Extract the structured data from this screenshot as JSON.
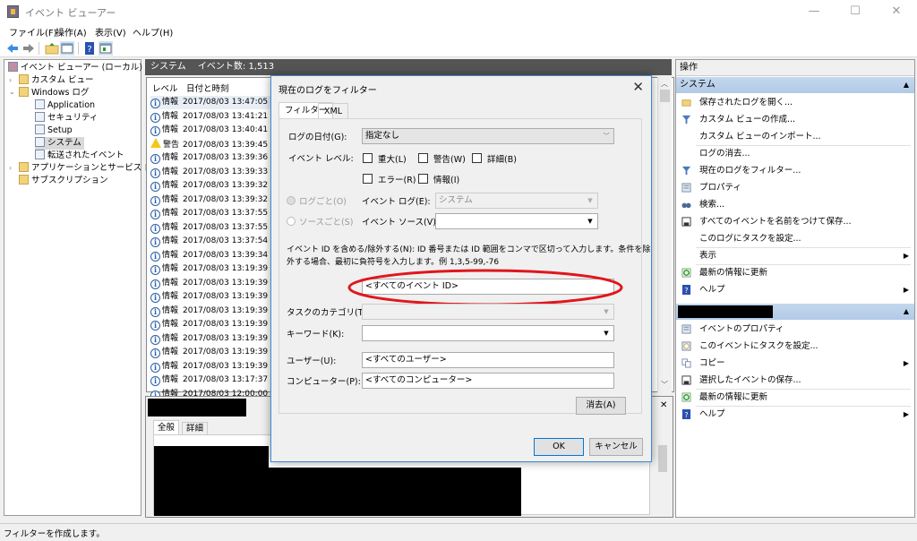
{
  "window": {
    "title": "イベント ビューアー",
    "controls": {
      "minimize": "—",
      "maximize": "☐",
      "close": "✕"
    }
  },
  "menubar": [
    "ファイル(F)",
    "操作(A)",
    "表示(V)",
    "ヘルプ(H)"
  ],
  "toolbar": {
    "icons": [
      "back-arrow-icon",
      "forward-arrow-icon",
      "up-folder-icon",
      "show-hide-tree-icon",
      "help-icon",
      "show-hide-action-pane-icon"
    ]
  },
  "tree": {
    "root": "イベント ビューアー (ローカル)",
    "items": [
      {
        "label": "カスタム ビュー",
        "level": 1,
        "expander": "›"
      },
      {
        "label": "Windows ログ",
        "level": 1,
        "expander": "⌄"
      },
      {
        "label": "Application",
        "level": 2
      },
      {
        "label": "セキュリティ",
        "level": 2
      },
      {
        "label": "Setup",
        "level": 2
      },
      {
        "label": "システム",
        "level": 2,
        "selected": true
      },
      {
        "label": "転送されたイベント",
        "level": 2
      },
      {
        "label": "アプリケーションとサービス ログ",
        "level": 1,
        "expander": "›"
      },
      {
        "label": "サブスクリプション",
        "level": 1
      }
    ]
  },
  "center": {
    "header_name": "システム",
    "header_count": "イベント数: 1,513",
    "columns": [
      "レベル",
      "日付と時刻"
    ],
    "events": [
      {
        "level": "情報",
        "type": "info",
        "datetime": "2017/08/03 13:47:05"
      },
      {
        "level": "情報",
        "type": "info",
        "datetime": "2017/08/03 13:41:21"
      },
      {
        "level": "情報",
        "type": "info",
        "datetime": "2017/08/03 13:40:41"
      },
      {
        "level": "警告",
        "type": "warning",
        "datetime": "2017/08/03 13:39:45"
      },
      {
        "level": "情報",
        "type": "info",
        "datetime": "2017/08/03 13:39:36"
      },
      {
        "level": "情報",
        "type": "info",
        "datetime": "2017/08/03 13:39:33"
      },
      {
        "level": "情報",
        "type": "info",
        "datetime": "2017/08/03 13:39:32"
      },
      {
        "level": "情報",
        "type": "info",
        "datetime": "2017/08/03 13:39:32"
      },
      {
        "level": "情報",
        "type": "info",
        "datetime": "2017/08/03 13:37:55"
      },
      {
        "level": "情報",
        "type": "info",
        "datetime": "2017/08/03 13:37:55"
      },
      {
        "level": "情報",
        "type": "info",
        "datetime": "2017/08/03 13:37:54"
      },
      {
        "level": "情報",
        "type": "info",
        "datetime": "2017/08/03 13:39:34"
      },
      {
        "level": "情報",
        "type": "info",
        "datetime": "2017/08/03 13:19:39"
      },
      {
        "level": "情報",
        "type": "info",
        "datetime": "2017/08/03 13:19:39"
      },
      {
        "level": "情報",
        "type": "info",
        "datetime": "2017/08/03 13:19:39"
      },
      {
        "level": "情報",
        "type": "info",
        "datetime": "2017/08/03 13:19:39"
      },
      {
        "level": "情報",
        "type": "info",
        "datetime": "2017/08/03 13:19:39"
      },
      {
        "level": "情報",
        "type": "info",
        "datetime": "2017/08/03 13:19:39"
      },
      {
        "level": "情報",
        "type": "info",
        "datetime": "2017/08/03 13:19:39"
      },
      {
        "level": "情報",
        "type": "info",
        "datetime": "2017/08/03 13:19:39"
      },
      {
        "level": "情報",
        "type": "info",
        "datetime": "2017/08/03 13:17:37"
      },
      {
        "level": "情報",
        "type": "info",
        "datetime": "2017/08/03 12:00:00"
      }
    ],
    "detail_tabs": [
      "全般",
      "詳細"
    ],
    "detail_close": "✕"
  },
  "dialog": {
    "title": "現在のログをフィルター",
    "close": "✕",
    "tabs": [
      "フィルター",
      "XML"
    ],
    "log_date_label": "ログの日付(G):",
    "log_date_value": "指定なし",
    "event_level_label": "イベント レベル:",
    "levels": [
      {
        "label": "重大(L)",
        "checked": false
      },
      {
        "label": "警告(W)",
        "checked": false
      },
      {
        "label": "詳細(B)",
        "checked": false
      },
      {
        "label": "エラー(R)",
        "checked": false
      },
      {
        "label": "情報(I)",
        "checked": false
      }
    ],
    "by_log_label": "ログごと(O)",
    "by_source_label": "ソースごと(S)",
    "event_log_label": "イベント ログ(E):",
    "event_log_value": "システム",
    "event_source_label": "イベント ソース(V):",
    "event_source_value": "",
    "event_id_help_1": "イベント ID を含める/除外する(N): ID 番号または ID 範囲をコンマで区切って入力します。条件を除",
    "event_id_help_2": "外する場合、最初に負符号を入力します。例 1,3,5-99,-76",
    "event_id_value": "<すべてのイベント ID>",
    "task_category_label": "タスクのカテゴリ(T):",
    "keyword_label": "キーワード(K):",
    "user_label": "ユーザー(U):",
    "user_value": "<すべてのユーザー>",
    "computer_label": "コンピューター(P):",
    "computer_value": "<すべてのコンピューター>",
    "clear_button": "消去(A)",
    "ok_button": "OK",
    "cancel_button": "キャンセル",
    "highlight_color": "#e0161c"
  },
  "actions": {
    "header": "操作",
    "section1_title": "システム",
    "section1": [
      {
        "label": "保存されたログを開く...",
        "icon": "open-folder-icon"
      },
      {
        "label": "カスタム ビューの作成...",
        "icon": "filter-icon"
      },
      {
        "label": "カスタム ビューのインポート...",
        "icon": ""
      },
      {
        "label": "ログの消去...",
        "icon": ""
      },
      {
        "label": "現在のログをフィルター...",
        "icon": "filter-icon"
      },
      {
        "label": "プロパティ",
        "icon": "properties-icon"
      },
      {
        "label": "検索...",
        "icon": "binoculars-icon"
      },
      {
        "label": "すべてのイベントを名前をつけて保存...",
        "icon": "save-icon"
      },
      {
        "label": "このログにタスクを設定...",
        "icon": ""
      },
      {
        "label": "表示",
        "icon": "",
        "submenu": true
      },
      {
        "label": "最新の情報に更新",
        "icon": "refresh-icon"
      },
      {
        "label": "ヘルプ",
        "icon": "help-icon",
        "submenu": true
      }
    ],
    "section2": [
      {
        "label": "イベントのプロパティ",
        "icon": "properties-icon"
      },
      {
        "label": "このイベントにタスクを設定...",
        "icon": "task-icon"
      },
      {
        "label": "コピー",
        "icon": "copy-icon",
        "submenu": true
      },
      {
        "label": "選択したイベントの保存...",
        "icon": "save-icon"
      },
      {
        "label": "最新の情報に更新",
        "icon": "refresh-icon"
      },
      {
        "label": "ヘルプ",
        "icon": "help-icon",
        "submenu": true
      }
    ],
    "collapse": "▲",
    "submenu_arrow": "▶"
  },
  "statusbar": {
    "text": "フィルターを作成します。"
  }
}
